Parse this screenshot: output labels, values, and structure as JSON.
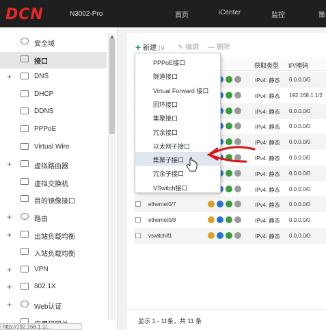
{
  "header": {
    "logo": "DCN",
    "model": "N3002-Pro",
    "nav": [
      "首页",
      "iCenter",
      "监控",
      "策"
    ]
  },
  "sidebar": {
    "items": [
      {
        "label": "安全域",
        "expand": "",
        "icon": "security-zone-icon"
      },
      {
        "label": "接口",
        "expand": "",
        "icon": "interface-icon",
        "active": true
      },
      {
        "label": "DNS",
        "expand": "+",
        "icon": "dns-icon"
      },
      {
        "label": "DHCP",
        "expand": "",
        "icon": "dhcp-icon"
      },
      {
        "label": "DDNS",
        "expand": "",
        "icon": "ddns-icon"
      },
      {
        "label": "PPPoE",
        "expand": "",
        "icon": "pppoe-icon"
      },
      {
        "label": "Virtual Wire",
        "expand": "",
        "icon": "virtual-wire-icon"
      },
      {
        "label": "虚拟路由器",
        "expand": "+",
        "icon": "virtual-router-icon"
      },
      {
        "label": "虚拟交换机",
        "expand": "",
        "icon": "virtual-switch-icon"
      },
      {
        "label": "目的镜像接口",
        "expand": "",
        "icon": "mirror-interface-icon"
      },
      {
        "label": "路由",
        "expand": "+",
        "icon": "route-icon"
      },
      {
        "label": "出站负载均衡",
        "expand": "+",
        "icon": "outbound-lb-icon"
      },
      {
        "label": "入站负载均衡",
        "expand": "",
        "icon": "inbound-lb-icon"
      },
      {
        "label": "VPN",
        "expand": "+",
        "icon": "vpn-icon"
      },
      {
        "label": "802.1X",
        "expand": "+",
        "icon": "dot1x-icon"
      },
      {
        "label": "Web认证",
        "expand": "+",
        "icon": "web-auth-icon"
      },
      {
        "label": "应用层网关",
        "expand": "",
        "icon": "alg-icon"
      }
    ]
  },
  "toolbar": {
    "new_label": "新建",
    "edit_label": "编辑",
    "delete_label": "删除"
  },
  "table": {
    "columns": [
      "获取类型",
      "IP/掩码"
    ],
    "rows": [
      {
        "name": "",
        "type": "IPv4: 静态",
        "ip": "0.0.0.0/0"
      },
      {
        "name": "",
        "type": "IPv4: 静态",
        "ip": "192.168.1.1/2"
      },
      {
        "name": "",
        "type": "IPv4: 静态",
        "ip": "0.0.0.0/0"
      },
      {
        "name": "",
        "type": "IPv4: 静态",
        "ip": "0.0.0.0/0"
      },
      {
        "name": "",
        "type": "IPv4: 静态",
        "ip": "0.0.0.0/0"
      },
      {
        "name": "",
        "type": "IPv4: 静态",
        "ip": "0.0.0.0/0"
      },
      {
        "name": "",
        "type": "IPv4: 静态",
        "ip": "0.0.0.0/0"
      },
      {
        "name": "",
        "type": "IPv4: 静态",
        "ip": "0.0.0.0/0"
      },
      {
        "name": "ethernet0/7",
        "type": "IPv4: 静态",
        "ip": "0.0.0.0/0"
      },
      {
        "name": "ethernet0/8",
        "type": "IPv4: 静态",
        "ip": "0.0.0.0/0"
      },
      {
        "name": "vswitchif1",
        "type": "IPv4: 静态",
        "ip": "0.0.0.0/0"
      }
    ]
  },
  "new_menu": {
    "items": [
      "PPPoE接口",
      "隧道接口",
      "Virtual Forward 接口",
      "回环接口",
      "集聚接口",
      "冗余接口",
      "以太网子接口",
      "集聚子接口",
      "冗余子接口",
      "VSwitch接口"
    ],
    "hovered_index": 7
  },
  "footer": {
    "summary": "显示 1 - 11条，共 11 条"
  },
  "status_url": "http://192.168.1.1/..."
}
